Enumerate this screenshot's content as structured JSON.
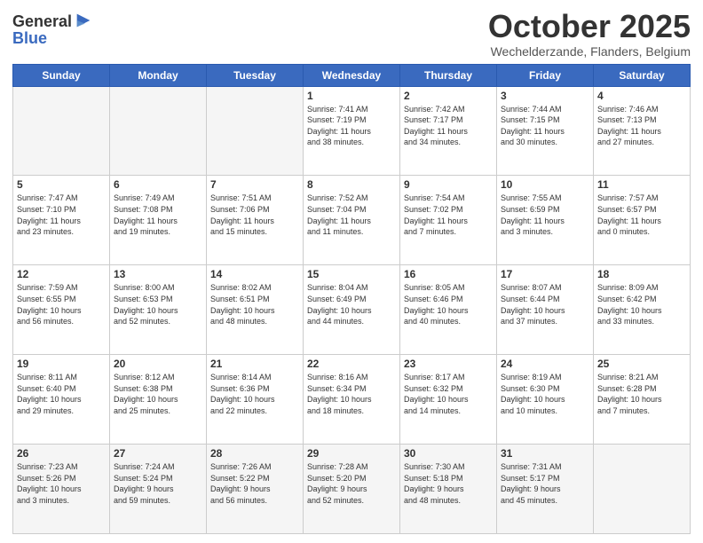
{
  "header": {
    "logo_line1": "General",
    "logo_line2": "Blue",
    "month": "October 2025",
    "location": "Wechelderzande, Flanders, Belgium"
  },
  "days_of_week": [
    "Sunday",
    "Monday",
    "Tuesday",
    "Wednesday",
    "Thursday",
    "Friday",
    "Saturday"
  ],
  "weeks": [
    [
      {
        "day": "",
        "info": ""
      },
      {
        "day": "",
        "info": ""
      },
      {
        "day": "",
        "info": ""
      },
      {
        "day": "1",
        "info": "Sunrise: 7:41 AM\nSunset: 7:19 PM\nDaylight: 11 hours\nand 38 minutes."
      },
      {
        "day": "2",
        "info": "Sunrise: 7:42 AM\nSunset: 7:17 PM\nDaylight: 11 hours\nand 34 minutes."
      },
      {
        "day": "3",
        "info": "Sunrise: 7:44 AM\nSunset: 7:15 PM\nDaylight: 11 hours\nand 30 minutes."
      },
      {
        "day": "4",
        "info": "Sunrise: 7:46 AM\nSunset: 7:13 PM\nDaylight: 11 hours\nand 27 minutes."
      }
    ],
    [
      {
        "day": "5",
        "info": "Sunrise: 7:47 AM\nSunset: 7:10 PM\nDaylight: 11 hours\nand 23 minutes."
      },
      {
        "day": "6",
        "info": "Sunrise: 7:49 AM\nSunset: 7:08 PM\nDaylight: 11 hours\nand 19 minutes."
      },
      {
        "day": "7",
        "info": "Sunrise: 7:51 AM\nSunset: 7:06 PM\nDaylight: 11 hours\nand 15 minutes."
      },
      {
        "day": "8",
        "info": "Sunrise: 7:52 AM\nSunset: 7:04 PM\nDaylight: 11 hours\nand 11 minutes."
      },
      {
        "day": "9",
        "info": "Sunrise: 7:54 AM\nSunset: 7:02 PM\nDaylight: 11 hours\nand 7 minutes."
      },
      {
        "day": "10",
        "info": "Sunrise: 7:55 AM\nSunset: 6:59 PM\nDaylight: 11 hours\nand 3 minutes."
      },
      {
        "day": "11",
        "info": "Sunrise: 7:57 AM\nSunset: 6:57 PM\nDaylight: 11 hours\nand 0 minutes."
      }
    ],
    [
      {
        "day": "12",
        "info": "Sunrise: 7:59 AM\nSunset: 6:55 PM\nDaylight: 10 hours\nand 56 minutes."
      },
      {
        "day": "13",
        "info": "Sunrise: 8:00 AM\nSunset: 6:53 PM\nDaylight: 10 hours\nand 52 minutes."
      },
      {
        "day": "14",
        "info": "Sunrise: 8:02 AM\nSunset: 6:51 PM\nDaylight: 10 hours\nand 48 minutes."
      },
      {
        "day": "15",
        "info": "Sunrise: 8:04 AM\nSunset: 6:49 PM\nDaylight: 10 hours\nand 44 minutes."
      },
      {
        "day": "16",
        "info": "Sunrise: 8:05 AM\nSunset: 6:46 PM\nDaylight: 10 hours\nand 40 minutes."
      },
      {
        "day": "17",
        "info": "Sunrise: 8:07 AM\nSunset: 6:44 PM\nDaylight: 10 hours\nand 37 minutes."
      },
      {
        "day": "18",
        "info": "Sunrise: 8:09 AM\nSunset: 6:42 PM\nDaylight: 10 hours\nand 33 minutes."
      }
    ],
    [
      {
        "day": "19",
        "info": "Sunrise: 8:11 AM\nSunset: 6:40 PM\nDaylight: 10 hours\nand 29 minutes."
      },
      {
        "day": "20",
        "info": "Sunrise: 8:12 AM\nSunset: 6:38 PM\nDaylight: 10 hours\nand 25 minutes."
      },
      {
        "day": "21",
        "info": "Sunrise: 8:14 AM\nSunset: 6:36 PM\nDaylight: 10 hours\nand 22 minutes."
      },
      {
        "day": "22",
        "info": "Sunrise: 8:16 AM\nSunset: 6:34 PM\nDaylight: 10 hours\nand 18 minutes."
      },
      {
        "day": "23",
        "info": "Sunrise: 8:17 AM\nSunset: 6:32 PM\nDaylight: 10 hours\nand 14 minutes."
      },
      {
        "day": "24",
        "info": "Sunrise: 8:19 AM\nSunset: 6:30 PM\nDaylight: 10 hours\nand 10 minutes."
      },
      {
        "day": "25",
        "info": "Sunrise: 8:21 AM\nSunset: 6:28 PM\nDaylight: 10 hours\nand 7 minutes."
      }
    ],
    [
      {
        "day": "26",
        "info": "Sunrise: 7:23 AM\nSunset: 5:26 PM\nDaylight: 10 hours\nand 3 minutes."
      },
      {
        "day": "27",
        "info": "Sunrise: 7:24 AM\nSunset: 5:24 PM\nDaylight: 9 hours\nand 59 minutes."
      },
      {
        "day": "28",
        "info": "Sunrise: 7:26 AM\nSunset: 5:22 PM\nDaylight: 9 hours\nand 56 minutes."
      },
      {
        "day": "29",
        "info": "Sunrise: 7:28 AM\nSunset: 5:20 PM\nDaylight: 9 hours\nand 52 minutes."
      },
      {
        "day": "30",
        "info": "Sunrise: 7:30 AM\nSunset: 5:18 PM\nDaylight: 9 hours\nand 48 minutes."
      },
      {
        "day": "31",
        "info": "Sunrise: 7:31 AM\nSunset: 5:17 PM\nDaylight: 9 hours\nand 45 minutes."
      },
      {
        "day": "",
        "info": ""
      }
    ]
  ]
}
